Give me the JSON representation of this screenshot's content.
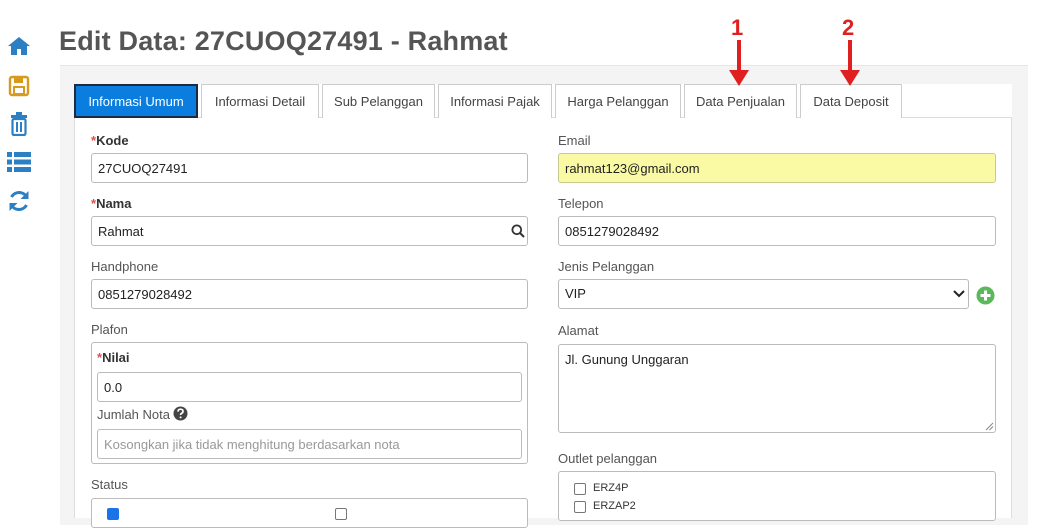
{
  "page": {
    "title": "Edit Data: 27CUOQ27491 - Rahmat"
  },
  "colors": {
    "accent": "#0a7ddf",
    "icon_blue": "#2c7fc2",
    "save_icon": "#d79a1e",
    "add_green": "#5cb85c",
    "annotation_red": "#e02020",
    "highlight_field": "#fafaa5"
  },
  "sidebar": {
    "icons": [
      {
        "name": "home-icon"
      },
      {
        "name": "save-icon"
      },
      {
        "name": "trash-icon"
      },
      {
        "name": "list-icon"
      },
      {
        "name": "refresh-icon"
      }
    ]
  },
  "tabs": [
    {
      "label": "Informasi Umum",
      "active": true
    },
    {
      "label": "Informasi Detail"
    },
    {
      "label": "Sub Pelanggan"
    },
    {
      "label": "Informasi Pajak"
    },
    {
      "label": "Harga Pelanggan"
    },
    {
      "label": "Data Penjualan"
    },
    {
      "label": "Data Deposit"
    }
  ],
  "annotations": {
    "one": "1",
    "two": "2"
  },
  "form": {
    "required_mark": "*",
    "kode": {
      "label": "Kode",
      "value": "27CUOQ27491"
    },
    "nama": {
      "label": "Nama",
      "value": "Rahmat"
    },
    "handphone": {
      "label": "Handphone",
      "value": "0851279028492"
    },
    "plafon": {
      "label": "Plafon",
      "nilai": {
        "label": "Nilai",
        "value": "0.0"
      },
      "jumlah_nota": {
        "label": "Jumlah Nota",
        "placeholder": "Kosongkan jika tidak menghitung berdasarkan nota"
      }
    },
    "status": {
      "label": "Status"
    },
    "email": {
      "label": "Email",
      "value": "rahmat123@gmail.com"
    },
    "telepon": {
      "label": "Telepon",
      "value": "0851279028492"
    },
    "jenis_pelanggan": {
      "label": "Jenis Pelanggan",
      "value": "VIP"
    },
    "alamat": {
      "label": "Alamat",
      "value": "Jl. Gunung Unggaran"
    },
    "outlet": {
      "label": "Outlet pelanggan",
      "items": [
        "ERZ4P",
        "ERZAP2"
      ]
    }
  }
}
